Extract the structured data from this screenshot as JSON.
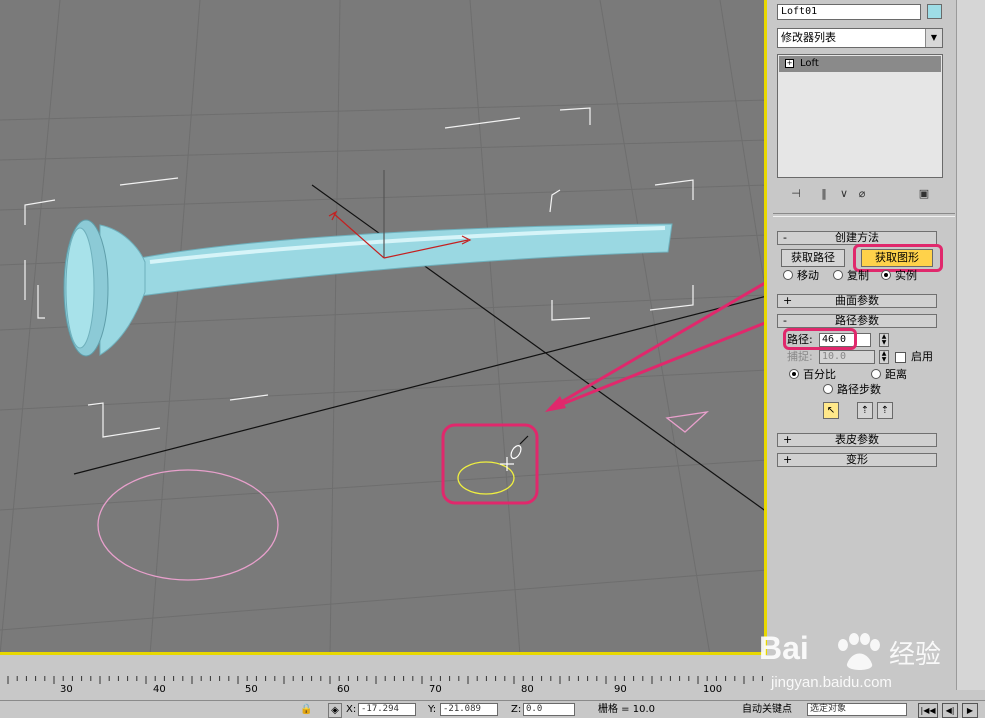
{
  "command_panel": {
    "object_name": "Loft01",
    "object_color": "#9edde6",
    "modifier_list": "修改器列表",
    "stack_item": "Loft",
    "creation_method": {
      "title": "创建方法",
      "get_path": "获取路径",
      "get_shape": "获取图形",
      "move": "移动",
      "copy": "复制",
      "instance": "实例"
    },
    "surface_params": "曲面参数",
    "path_params": {
      "title": "路径参数",
      "path_label": "路径:",
      "path_value": "46.0",
      "snap_label": "捕捉:",
      "snap_value": "10.0",
      "enable_label": "启用",
      "percentage": "百分比",
      "distance": "距离",
      "path_steps": "路径步数"
    },
    "skin_params": "表皮参数",
    "deformation": "变形"
  },
  "timeline": {
    "ticks": [
      "30",
      "40",
      "50",
      "60",
      "70",
      "80",
      "90",
      "100"
    ]
  },
  "status_bar": {
    "x_label": "X:",
    "x_value": "-17.294",
    "y_label": "Y:",
    "y_value": "-21.089",
    "z_label": "Z:",
    "z_value": "0.0",
    "grid": "栅格 = 10.0",
    "auto_key": "自动关键点",
    "selected": "选定对象"
  },
  "watermark": {
    "brand": "Bai",
    "suffix": "经验",
    "url": "jingyan.baidu.com"
  },
  "colors": {
    "viewport_bg": "#7a7a7a",
    "highlight": "#e0286c",
    "loft_object": "#9edde6",
    "active_border": "#e8d800"
  }
}
